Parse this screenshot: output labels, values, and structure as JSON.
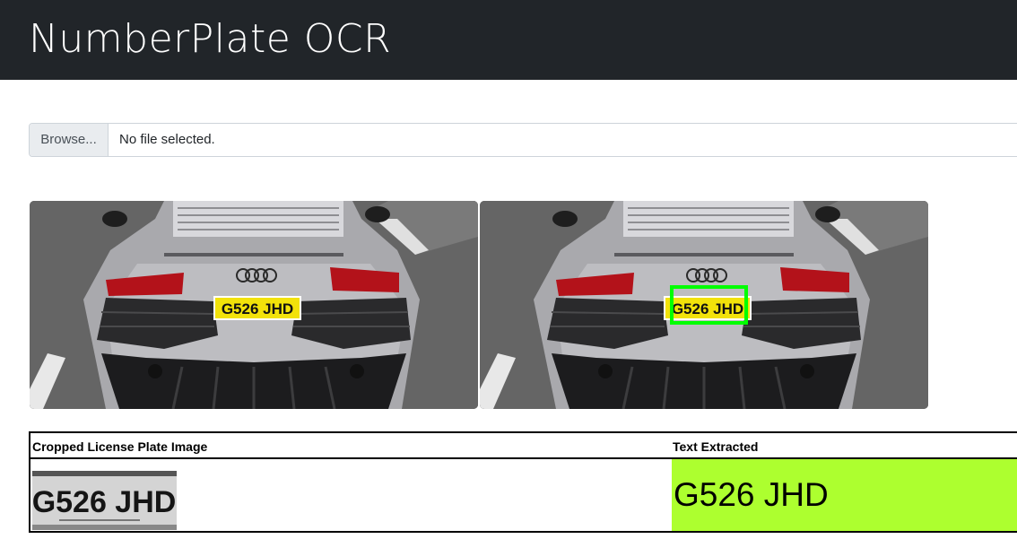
{
  "header": {
    "title": "NumberPlate OCR"
  },
  "upload": {
    "browse_label": "Browse...",
    "status": "No file selected."
  },
  "images": {
    "original_plate": "G526 JHD",
    "detected_plate": "G526 JHD",
    "detection_color": "#00ff00"
  },
  "results": {
    "col_image": "Cropped License Plate Image",
    "col_text": "Text Extracted",
    "cropped_plate": "G526 JHD",
    "extracted_text": "G526 JHD",
    "highlight_color": "#adff2f"
  }
}
